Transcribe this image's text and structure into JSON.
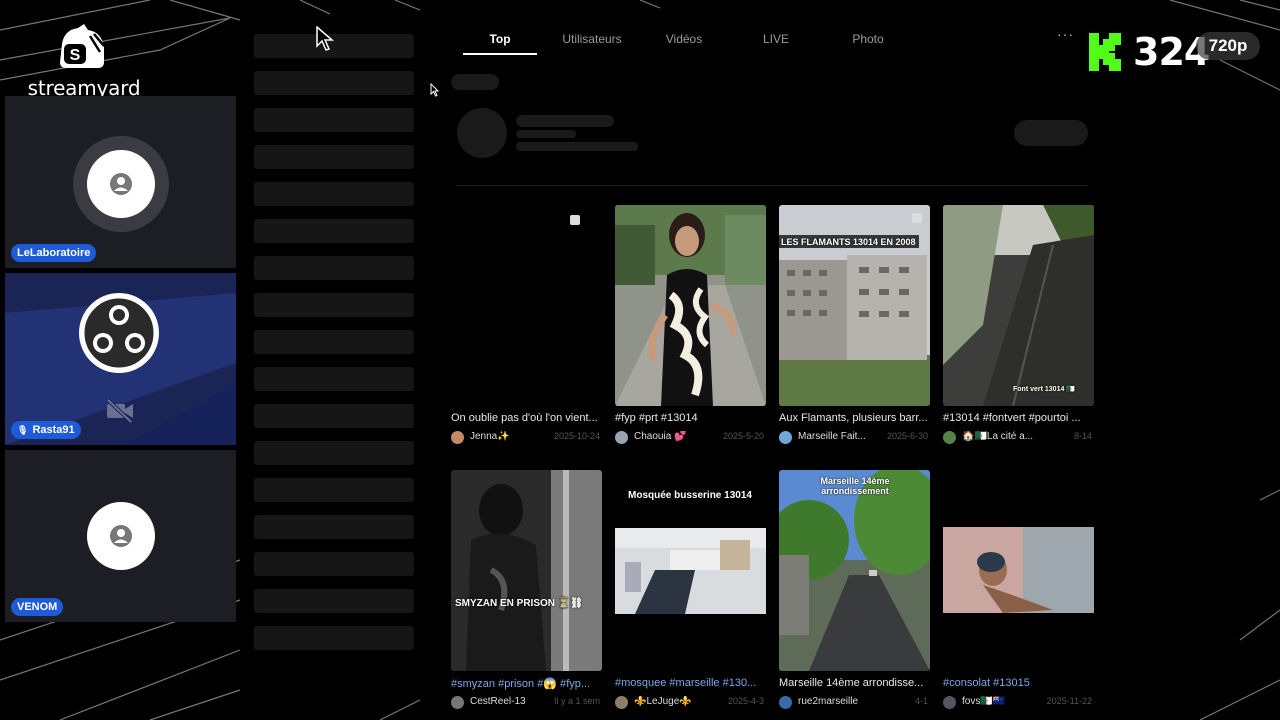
{
  "streamyard": {
    "wordmark": "streamyard",
    "participants": [
      {
        "name": "LeLaboratoire"
      },
      {
        "name": "Rasta91"
      },
      {
        "name": "VENOM"
      }
    ]
  },
  "stream_overlay": {
    "viewer_count": "324",
    "quality": "720p",
    "brand_color": "#53fc18"
  },
  "tiktok": {
    "tabs": [
      {
        "label": "Top",
        "active": true
      },
      {
        "label": "Utilisateurs",
        "active": false
      },
      {
        "label": "Vidéos",
        "active": false
      },
      {
        "label": "LIVE",
        "active": false
      },
      {
        "label": "Photo",
        "active": false
      }
    ],
    "more": "···",
    "videos": [
      {
        "caption": "On oublie pas d'où l'on vient...",
        "user": "Jenna✨",
        "date": "2025-10-24",
        "overlay": ""
      },
      {
        "caption": "#fyp #prt #13014",
        "user": "Chaouia 💕",
        "date": "2025-5-20",
        "overlay": ""
      },
      {
        "caption": "Aux Flamants, plusieurs barr...",
        "user": "Marseille Fait...",
        "date": "2025-6-30",
        "overlay": "LES FLAMANTS 13014 EN 2008"
      },
      {
        "caption": "#13014 #fontvert #pourtoi ...",
        "user": "🏠🇩🇿La cité a...",
        "date": "8-14",
        "overlay": "Font vert 13014 🇩🇿"
      },
      {
        "caption": "#smyzan #prison #😱 #fyp...",
        "user": "CestReel-13",
        "date": "Il y a 1 sem",
        "overlay": "SMYZAN EN PRISON ⏳⛓"
      },
      {
        "caption": "#mosquee #marseille #130...",
        "user": "⚜️LeJuge⚜️",
        "date": "2025-4-3",
        "overlay": "Mosquée busserine 13014"
      },
      {
        "caption": "Marseille 14ème arrondisse...",
        "user": "rue2marseille",
        "date": "4-1",
        "overlay": "Marseille 14ème arrondissement"
      },
      {
        "caption": "#consolat #13015",
        "user": "fovs🇩🇿🇳🇿",
        "date": "2025-11-22",
        "overlay": ""
      }
    ]
  }
}
